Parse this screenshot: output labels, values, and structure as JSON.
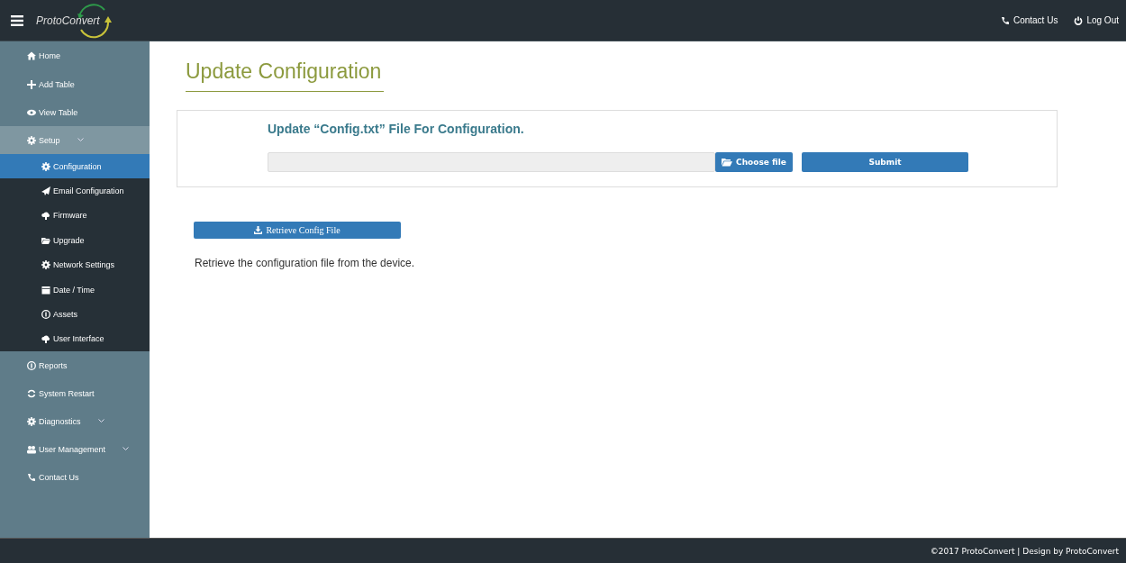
{
  "header": {
    "logo": "ProtoConvert",
    "links": [
      "Contact Us",
      "Log Out"
    ]
  },
  "sidebar": {
    "items": [
      {
        "label": "Home",
        "selected": false
      },
      {
        "label": "Add Table",
        "selected": false
      },
      {
        "label": "View Table",
        "selected": false
      },
      {
        "label": "Setup",
        "selected": false,
        "expanded": true,
        "children": [
          {
            "label": "Configuration",
            "selected": true
          },
          {
            "label": "Email Configuration",
            "selected": false
          },
          {
            "label": "Firmware",
            "selected": false
          },
          {
            "label": "Upgrade",
            "selected": false
          },
          {
            "label": "Network Settings",
            "selected": false
          },
          {
            "label": "Date / Time",
            "selected": false
          },
          {
            "label": "Assets",
            "selected": false
          },
          {
            "label": "User Interface",
            "selected": false
          }
        ]
      },
      {
        "label": "Reports",
        "selected": false
      },
      {
        "label": "System Restart",
        "selected": false
      },
      {
        "label": "Diagnostics",
        "selected": false,
        "expanded": false
      },
      {
        "label": "User Management",
        "selected": false,
        "expanded": false
      },
      {
        "label": "Contact Us",
        "selected": false
      }
    ]
  },
  "page": {
    "title": "Update Configuration",
    "upload": {
      "heading": "Update “Config.txt” File For Configuration.",
      "choose_button": "Choose file",
      "submit_button": "Submit"
    },
    "retrieve_button": "Retrieve Config File",
    "description": "Retrieve the configuration file from the device."
  },
  "footer": "©2017 ProtoConvert | Design by ProtoConvert"
}
